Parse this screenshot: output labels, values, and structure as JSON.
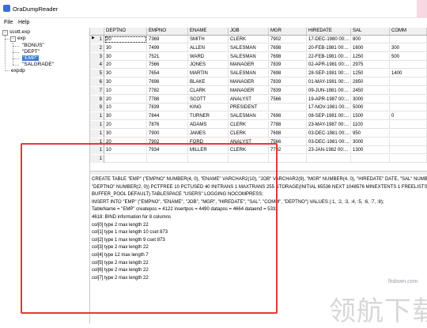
{
  "window": {
    "title": "OraDumpReader"
  },
  "menu": [
    "File",
    "Help"
  ],
  "tree": {
    "root": "scott.exp",
    "child": "exp",
    "tables": [
      "\"BONUS\"",
      "\"DEPT\"",
      "\"EMP\"",
      "\"SALGRADE\""
    ],
    "selected_index": 2,
    "second_root": "expdp"
  },
  "grid": {
    "columns": [
      "DEPTNO",
      "EMPNO",
      "ENAME",
      "JOB",
      "MGR",
      "HIREDATE",
      "SAL",
      "COMM"
    ],
    "rows": [
      [
        "1",
        "20",
        "7369",
        "SMITH",
        "CLERK",
        "7902",
        "17-DEC-1980 00:...",
        "800",
        ""
      ],
      [
        "2",
        "30",
        "7499",
        "ALLEN",
        "SALESMAN",
        "7698",
        "20-FEB-1981 00:...",
        "1600",
        "300"
      ],
      [
        "3",
        "30",
        "7521",
        "WARD",
        "SALESMAN",
        "7698",
        "22-FEB-1981 00:...",
        "1250",
        "500"
      ],
      [
        "4",
        "20",
        "7566",
        "JONES",
        "MANAGER",
        "7839",
        "02-APR-1981 00:...",
        "2975",
        ""
      ],
      [
        "5",
        "30",
        "7654",
        "MARTIN",
        "SALESMAN",
        "7698",
        "28-SEP-1981 00:...",
        "1250",
        "1400"
      ],
      [
        "6",
        "30",
        "7698",
        "BLAKE",
        "MANAGER",
        "7839",
        "01-MAY-1981 00:...",
        "2850",
        ""
      ],
      [
        "7",
        "10",
        "7782",
        "CLARK",
        "MANAGER",
        "7839",
        "09-JUN-1981 00:...",
        "2450",
        ""
      ],
      [
        "8",
        "20",
        "7788",
        "SCOTT",
        "ANALYST",
        "7566",
        "19-APR-1987 00:...",
        "3000",
        ""
      ],
      [
        "9",
        "10",
        "7839",
        "KING",
        "PRESIDENT",
        "",
        "17-NOV-1981 00:...",
        "5000",
        ""
      ],
      [
        "1",
        "30",
        "7844",
        "TURNER",
        "SALESMAN",
        "7698",
        "08-SEP-1981 00:...",
        "1500",
        "0"
      ],
      [
        "1",
        "20",
        "7876",
        "ADAMS",
        "CLERK",
        "7788",
        "23-MAY-1987 00:...",
        "1100",
        ""
      ],
      [
        "1",
        "30",
        "7900",
        "JAMES",
        "CLERK",
        "7698",
        "03-DEC-1981 00:...",
        "950",
        ""
      ],
      [
        "1",
        "20",
        "7902",
        "FORD",
        "ANALYST",
        "7566",
        "03-DEC-1981 00:...",
        "3000",
        ""
      ],
      [
        "1",
        "10",
        "7934",
        "MILLER",
        "CLERK",
        "7782",
        "23-JAN-1982 00:...",
        "1300",
        ""
      ],
      [
        "1",
        "",
        "",
        "",
        "",
        "",
        "",
        "",
        ""
      ]
    ]
  },
  "log": [
    "CREATE TABLE \"EMP\" (\"EMPNO\" NUMBER(4, 0), \"ENAME\" VARCHAR2(10), \"JOB\" VARCHAR2(9), \"MGR\" NUMBER(4, 0), \"HIREDATE\" DATE, \"SAL\" NUMBER(7, 2), \"C",
    "\"DEPTNO\" NUMBER(2, 0)) PCTFREE 10 PCTUSED 40 INITRANS 1 MAXTRANS 255 STORAGE(INITIAL 65536 NEXT 1048576 MINEXTENTS 1 FREELISTS 1 FREELIST",
    "BUFFER_POOL DEFAULT) TABLESPACE \"USERS\" LOGGING NOCOMPRESS;",
    "INSERT INTO \"EMP\" (\"EMPNO\", \"ENAME\", \"JOB\", \"MGR\", \"HIREDATE\", \"SAL\", \"COMM\", \"DEPTNO\") VALUES (:1, :2, :3, :4, :5, :6, :7, :8);",
    "TableName = \"EMP\" createpos = 4122 insertpos = 4490 datapos = 4664 dataend = 5332",
    "4618: BIND information for 8 columns",
    "col[0] type 2 max length 22",
    "col[1] type 1 max length 10 cset 873",
    "col[2] type 1 max length 9 cset 873",
    "col[3] type 2 max length 22",
    "col[4] type 12 max length 7",
    "col[5] type 2 max length 22",
    "col[6] type 2 max length 22",
    "col[7] type 2 max length 22"
  ],
  "watermark": {
    "url": "lhdown.com",
    "text": "领航下载"
  },
  "colors": {
    "selection": "#3b7bd6",
    "annotation": "#e53935"
  }
}
